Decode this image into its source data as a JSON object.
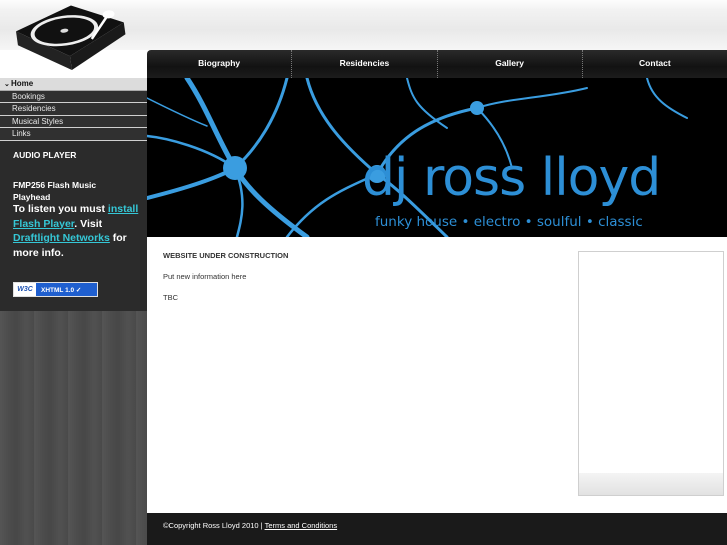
{
  "top_nav": {
    "tabs": [
      {
        "label": "Biography"
      },
      {
        "label": "Residencies"
      },
      {
        "label": "Gallery"
      },
      {
        "label": "Contact"
      }
    ]
  },
  "sidebar": {
    "items": [
      {
        "label": "Home"
      },
      {
        "label": "Bookings"
      },
      {
        "label": "Residencies"
      },
      {
        "label": "Musical Styles"
      },
      {
        "label": "Links"
      }
    ],
    "audio_player_title": "AUDIO PLAYER",
    "player_name": "FMP256 Flash Music Playhead",
    "flash_msg": {
      "prefix": "To listen you must ",
      "install_link": "install Flash Player",
      "mid": ". Visit ",
      "networks_link": "Draftlight Networks",
      "suffix": " for more info."
    },
    "w3c_badge": {
      "logo": "W3C",
      "text": "XHTML 1.0 ✓"
    }
  },
  "banner": {
    "title": "dj ross lloyd",
    "tagline": "funky house • electro • soulful • classic",
    "accent_color": "#2d8fd6"
  },
  "content": {
    "heading": "WEBSITE UNDER CONSTRUCTION",
    "text1": "Put new information here",
    "text2": "TBC"
  },
  "footer": {
    "copyright": "©Copyright Ross Lloyd 2010 | ",
    "terms_link": "Terms and Conditions"
  }
}
